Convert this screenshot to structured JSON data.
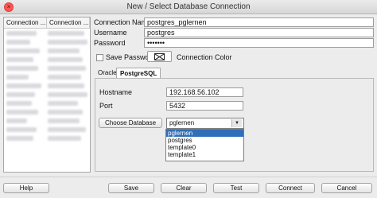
{
  "window": {
    "title": "New / Select Database Connection"
  },
  "connection_list": {
    "columns": [
      "Connection ...",
      "Connection ..."
    ]
  },
  "form": {
    "connection_name_label": "Connection Name",
    "connection_name_value": "postgres_pglernen",
    "username_label": "Username",
    "username_value": "postgres",
    "password_label": "Password",
    "password_value": "•••••••",
    "save_password_label": "Save Password",
    "connection_color_label": "Connection Color"
  },
  "tabs": [
    {
      "label": "Oracle"
    },
    {
      "label": "PostgreSQL"
    }
  ],
  "postgres": {
    "hostname_label": "Hostname",
    "hostname_value": "192.168.56.102",
    "port_label": "Port",
    "port_value": "5432",
    "choose_database_button": "Choose Database",
    "database_selected": "pglernen",
    "database_options": [
      "pglernen",
      "postgres",
      "template0",
      "template1"
    ]
  },
  "footer": {
    "help": "Help",
    "save": "Save",
    "clear": "Clear",
    "test": "Test",
    "connect": "Connect",
    "cancel": "Cancel"
  }
}
